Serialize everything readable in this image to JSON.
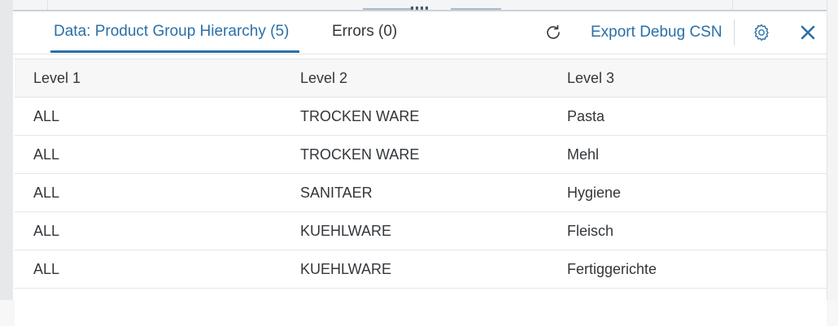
{
  "tabs": [
    {
      "label": "Data: Product Group Hierarchy (5)",
      "active": true
    },
    {
      "label": "Errors (0)",
      "active": false
    }
  ],
  "toolbar": {
    "refresh_icon": "refresh-icon",
    "export_label": "Export Debug CSN",
    "settings_icon": "gear-icon",
    "close_icon": "close-icon"
  },
  "table": {
    "columns": [
      "Level 1",
      "Level 2",
      "Level 3"
    ],
    "rows": [
      [
        "ALL",
        "TROCKEN WARE",
        "Pasta"
      ],
      [
        "ALL",
        "TROCKEN WARE",
        "Mehl"
      ],
      [
        "ALL",
        "SANITAER",
        "Hygiene"
      ],
      [
        "ALL",
        "KUEHLWARE",
        "Fleisch"
      ],
      [
        "ALL",
        "KUEHLWARE",
        "Fertiggerichte"
      ]
    ]
  },
  "colors": {
    "accent": "#2a6fa8",
    "text": "#32363a",
    "border": "#e5e5e5",
    "header_bg": "#f7f7f7"
  }
}
